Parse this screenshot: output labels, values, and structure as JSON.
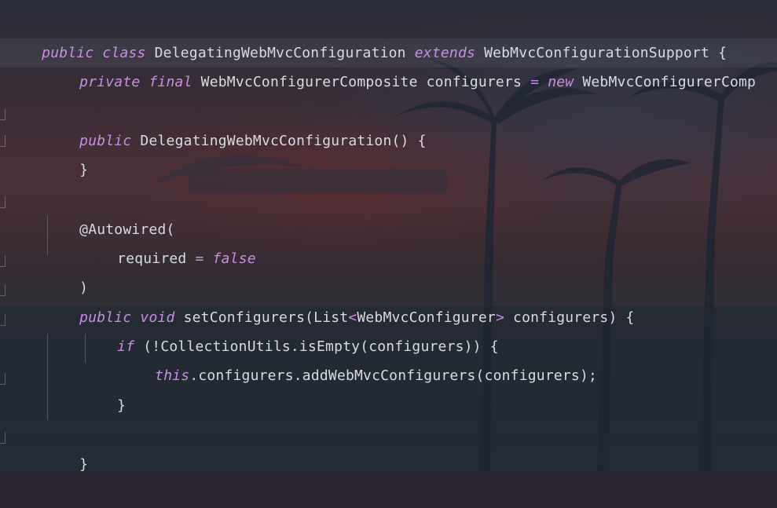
{
  "editor": {
    "language": "java",
    "colors": {
      "keyword": "#c88fe0",
      "text": "#d8dbe3",
      "current_line": "rgba(120,130,150,0.16)"
    },
    "lines": [
      {
        "t1": "public class",
        "t2": " DelegatingWebMvcConfiguration ",
        "t3": "extends",
        "t4": " WebMvcConfigurationSupport {"
      },
      {
        "t1": "private final",
        "t2": " WebMvcConfigurerComposite configurers ",
        "t3": "=",
        "t4": " ",
        "t5": "new",
        "t6": " WebMvcConfigurerComp"
      },
      {
        "t1": "public",
        "t2": " DelegatingWebMvcConfiguration() {"
      },
      {
        "t1": "}"
      },
      {
        "t1": "@Autowired("
      },
      {
        "t1": "required ",
        "t2": "=",
        "t3": " ",
        "t4": "false"
      },
      {
        "t1": ")"
      },
      {
        "t1": "public void",
        "t2": " setConfigurers(List",
        "t3": "<",
        "t4": "WebMvcConfigurer",
        "t5": ">",
        "t6": " configurers) {"
      },
      {
        "t1": "if",
        "t2": " (!CollectionUtils.isEmpty(configurers)) {"
      },
      {
        "t1": "this",
        "t2": ".configurers.addWebMvcConfigurers(configurers);"
      },
      {
        "t1": "}"
      },
      {
        "t1": "}"
      }
    ]
  }
}
